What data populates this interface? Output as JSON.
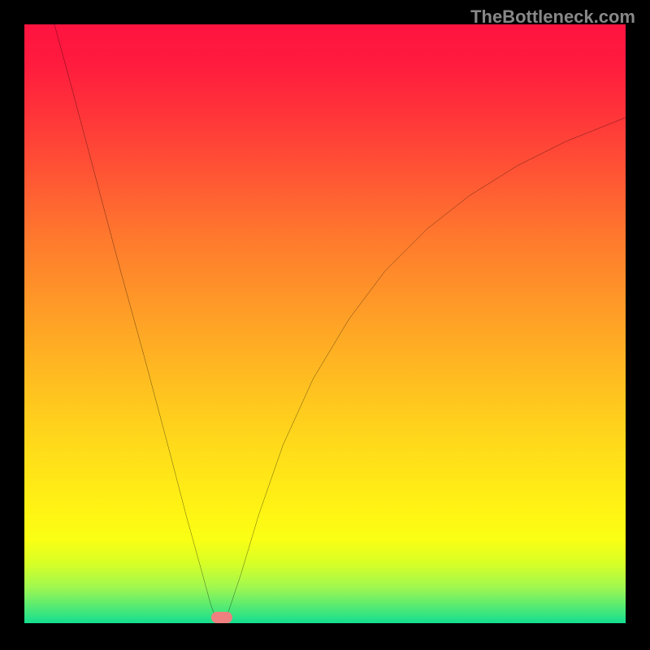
{
  "watermark": "TheBottleneck.com",
  "chart_data": {
    "type": "line",
    "title": "",
    "xlabel": "",
    "ylabel": "",
    "xlim": [
      0,
      100
    ],
    "ylim": [
      0,
      100
    ],
    "grid": false,
    "curve_points": [
      {
        "x": 5.0,
        "y": 100.0
      },
      {
        "x": 8.0,
        "y": 89.0
      },
      {
        "x": 12.0,
        "y": 74.0
      },
      {
        "x": 16.0,
        "y": 59.0
      },
      {
        "x": 20.0,
        "y": 44.5
      },
      {
        "x": 24.0,
        "y": 29.5
      },
      {
        "x": 27.0,
        "y": 18.0
      },
      {
        "x": 29.5,
        "y": 9.0
      },
      {
        "x": 31.0,
        "y": 3.5
      },
      {
        "x": 32.0,
        "y": 0.8
      },
      {
        "x": 32.8,
        "y": 0.4
      },
      {
        "x": 34.0,
        "y": 2.5
      },
      {
        "x": 36.0,
        "y": 8.5
      },
      {
        "x": 39.0,
        "y": 18.5
      },
      {
        "x": 43.0,
        "y": 30.0
      },
      {
        "x": 48.0,
        "y": 41.0
      },
      {
        "x": 54.0,
        "y": 51.0
      },
      {
        "x": 60.0,
        "y": 59.0
      },
      {
        "x": 67.0,
        "y": 66.0
      },
      {
        "x": 74.0,
        "y": 71.5
      },
      {
        "x": 82.0,
        "y": 76.5
      },
      {
        "x": 90.0,
        "y": 80.5
      },
      {
        "x": 100.0,
        "y": 84.5
      }
    ],
    "marker": {
      "x": 32.8,
      "y": 1.0,
      "color": "#f08080"
    }
  },
  "colors": {
    "background": "#000000",
    "curve": "#000000",
    "gradient_top": "#ff1440",
    "gradient_bottom": "#14de90"
  }
}
